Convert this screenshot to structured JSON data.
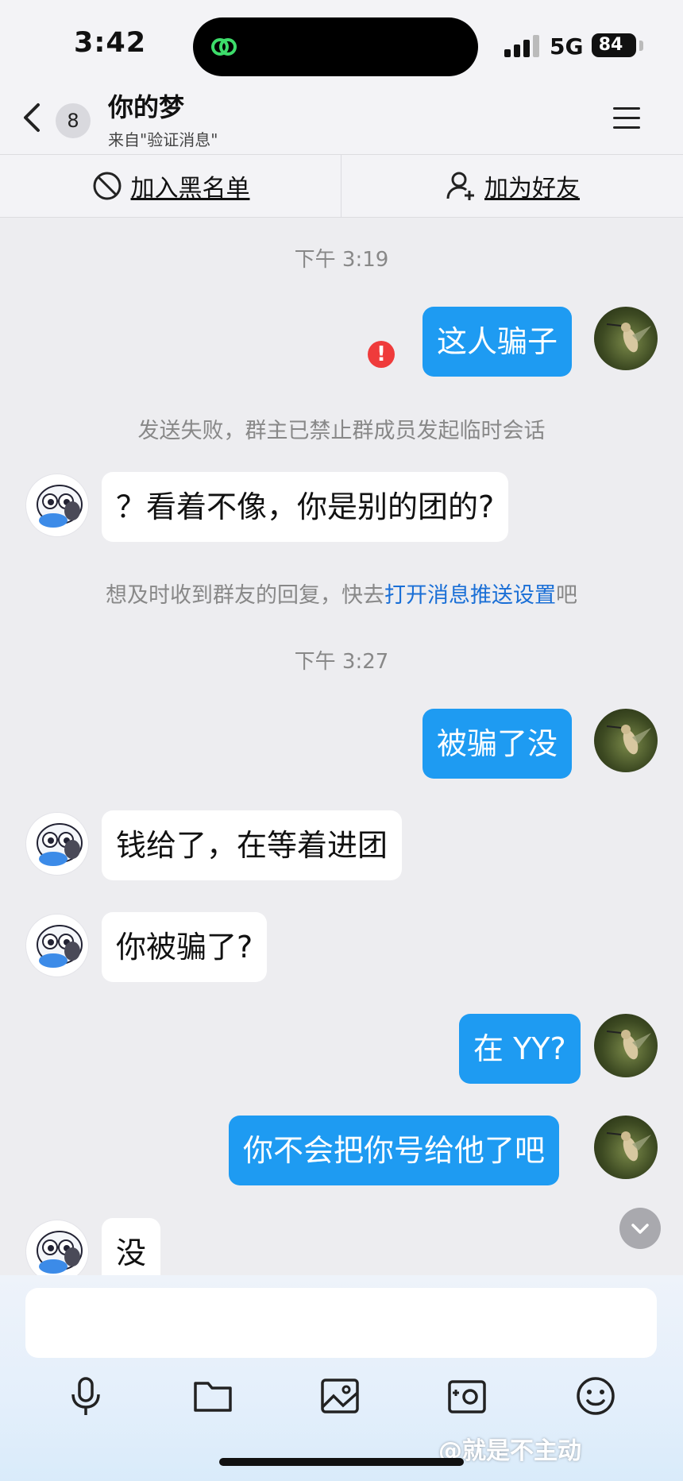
{
  "status_bar": {
    "time": "3:42",
    "network": "5G",
    "battery": "84"
  },
  "header": {
    "unread_count": "8",
    "name": "你的梦",
    "subtitle": "来自\"验证消息\""
  },
  "actions": {
    "block_label": "加入黑名单",
    "add_friend_label": "加为好友"
  },
  "chat": {
    "timestamp_1": "下午 3:19",
    "msg_1": "这人骗子",
    "failed_note": "发送失败，群主已禁止群成员发起临时会话",
    "msg_2": "？看着不像，你是别的团的?",
    "push_note_prefix": "想及时收到群友的回复，快去",
    "push_note_link": "打开消息推送设置",
    "push_note_suffix": "吧",
    "timestamp_2": "下午 3:27",
    "msg_3": "被骗了没",
    "msg_4": "钱给了，在等着进团",
    "msg_5": "你被骗了?",
    "msg_6": "在 YY?",
    "msg_7": "你不会把你号给他了吧",
    "msg_8": "没"
  },
  "toolbar": {
    "icons": [
      "microphone-icon",
      "folder-icon",
      "image-icon",
      "camera-icon",
      "emoji-icon"
    ]
  },
  "watermark": "@就是不主动",
  "colors": {
    "outgoing_bubble": "#1e9bf2",
    "link": "#1a6fd6",
    "error": "#ef3b3b"
  }
}
